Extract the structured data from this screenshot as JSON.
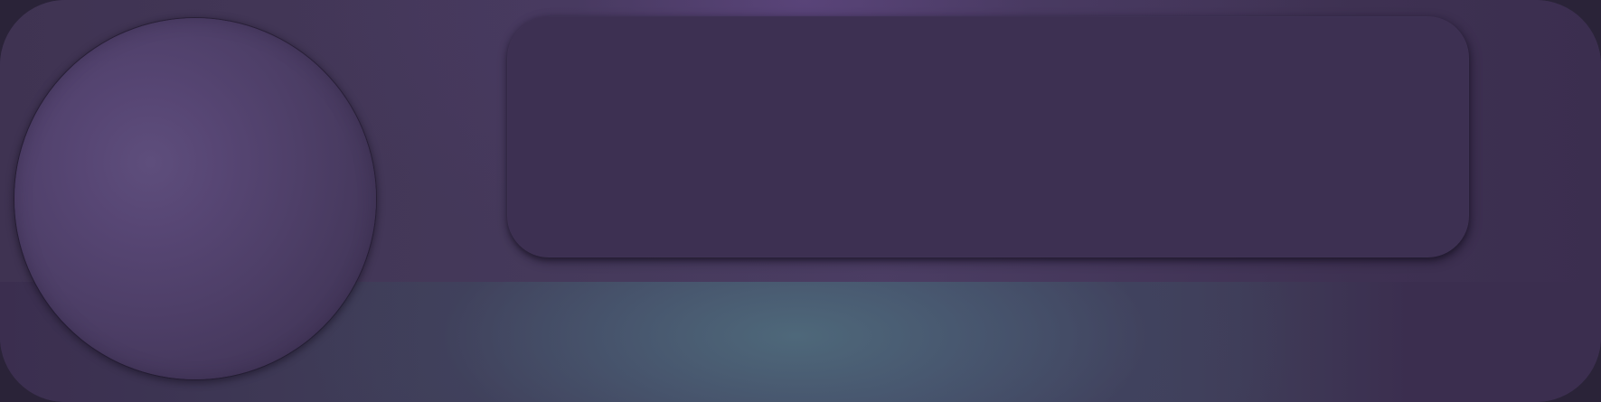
{
  "widget": {
    "theme": {
      "base": "#3c2f50",
      "accent_purple": "#5a447a",
      "accent_teal": "#4e687a",
      "orb_highlight": "#5e4e7c",
      "panel_fill": "#3d3052"
    },
    "orb": {
      "icon": "avatar-orb"
    },
    "panel": {
      "text": ""
    }
  }
}
